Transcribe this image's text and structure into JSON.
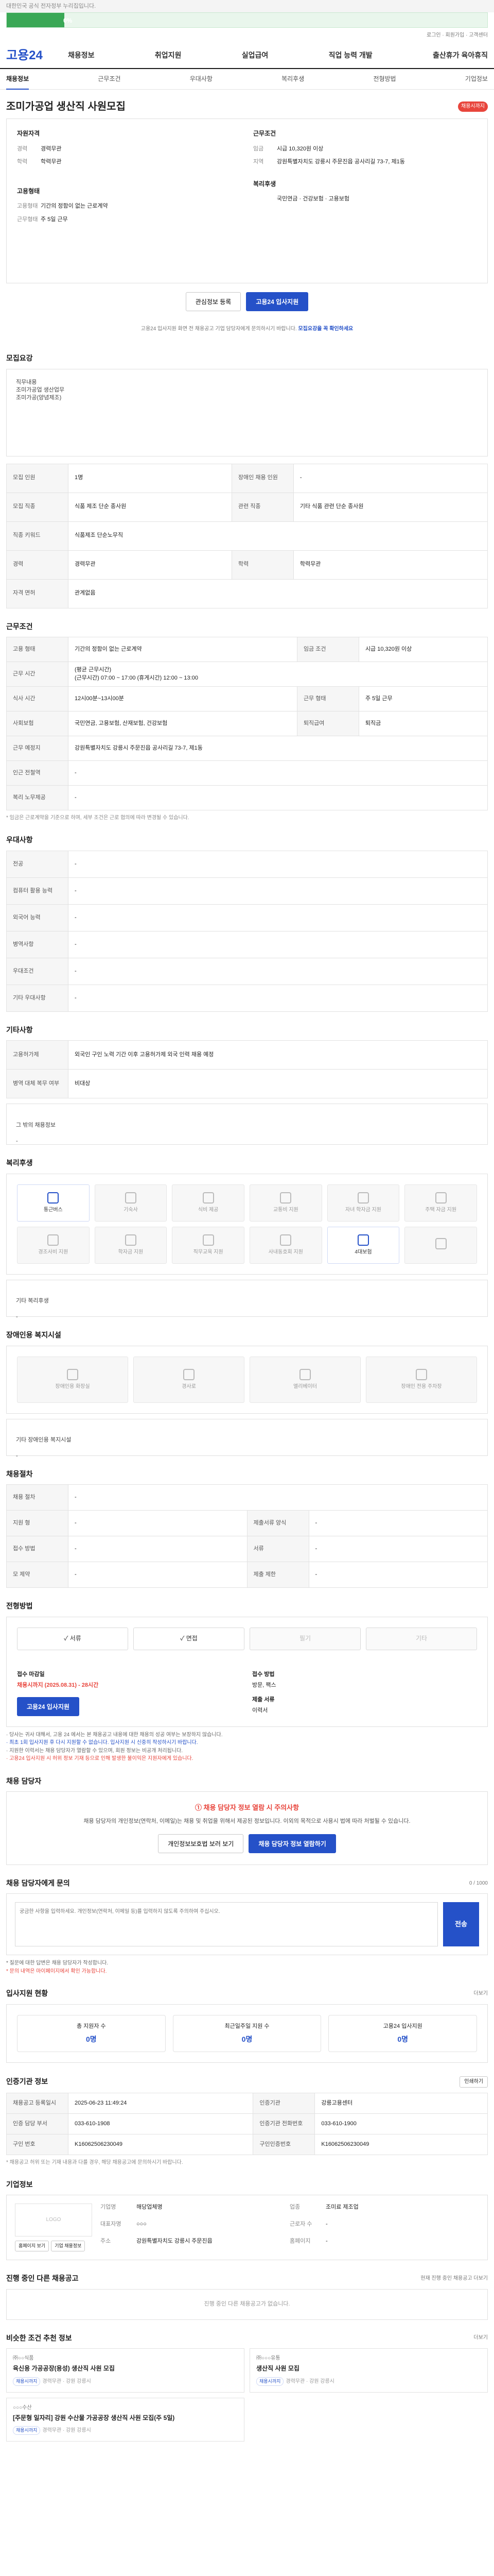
{
  "topbar": {
    "text": "대한민국 공식 전자정부 누리집입니다."
  },
  "notice": {
    "progress": 0.12,
    "progress_label": "0%"
  },
  "utility": {
    "links": "로그인 · 회원가입 · 고객센터"
  },
  "gnb": {
    "logo": "고용24",
    "menu": [
      "채용정보",
      "취업지원",
      "실업급여",
      "직업 능력 개발",
      "출산휴가 육아휴직"
    ]
  },
  "tabs": [
    "채용정보",
    "근무조건",
    "우대사항",
    "복리후생",
    "전형방법",
    "기업정보"
  ],
  "posting": {
    "title": "조미가공업 생산직 사원모집",
    "status_badge": "채용시까지",
    "summary": {
      "left_head": "자원자격",
      "left": [
        {
          "k": "경력",
          "v": "경력무관"
        },
        {
          "k": "학력",
          "v": "학력무관"
        }
      ],
      "left_head2": "고용형태",
      "left2": [
        {
          "k": "고용형태",
          "v": "기간의 정함이 없는 근로계약"
        },
        {
          "k": "근무형태",
          "v": "주 5일 근무"
        }
      ],
      "right_head": "근무조건",
      "right": [
        {
          "k": "임금",
          "v": "시급 10,320원 이상"
        },
        {
          "k": "지역",
          "v": "강원특별자치도 강릉시 주문진읍 공사리길 73-7, 제1동"
        }
      ],
      "right_head2": "복리후생",
      "right2": [
        {
          "k": "",
          "v": "국민연금 · 건강보험 · 고용보험"
        }
      ]
    },
    "buttons": {
      "save": "관심정보 등록",
      "apply": "고용24 입사지원"
    },
    "caption_pre": "고용24 입사지원 화면 전 채용공고 기업 담당자에게 문의하시기 바랍니다.",
    "caption_blue": "모집요강을 꼭 확인하세요"
  },
  "recruit_section": {
    "title": "모집요강",
    "body": "직무내용\n 조미가공업 생산업무\n 조미가공(양념제조)",
    "rows": [
      {
        "k": "모집 인원",
        "v": "1명",
        "k2": "장애인 채용 인원",
        "v2": "-"
      },
      {
        "k": "모집 직종",
        "v": "식품 제조 단순 종사원",
        "k2": "관련 직종",
        "v2": "기타 식품 관련 단순 종사원"
      },
      {
        "k": "직종 키워드",
        "v": "식품제조 단순노무직",
        "k2": "",
        "v2": ""
      },
      {
        "k": "경력",
        "v": "경력무관",
        "k2": "학력",
        "v2": "학력무관"
      },
      {
        "k": "자격 면허",
        "v": "관계없음",
        "k2": "",
        "v2": ""
      }
    ]
  },
  "conditions": {
    "title": "근무조건",
    "rows": [
      {
        "k": "고용 형태",
        "v": "기간의 정함이 없는 근로계약",
        "k2": "임금 조건",
        "v2": "시급 10,320원 이상"
      },
      {
        "k": "근무 시간",
        "v": "(평균 근무시간)\n(근무시간) 07:00 ~ 17:00 (휴게시간) 12:00 ~ 13:00",
        "k2": "",
        "v2": ""
      },
      {
        "k": "식사 시간",
        "v": "12시00분~13시00분",
        "k2": "근무 형태",
        "v2": "주 5일 근무"
      },
      {
        "k": "사회보험",
        "v": "국민연금, 고용보험, 산재보험, 건강보험",
        "k2": "퇴직급여",
        "v2": "퇴직금"
      },
      {
        "k": "근무 예정지",
        "v": "강원특별자치도 강릉시 주문진읍 공사리길 73-7, 제1동",
        "k2": "",
        "v2": ""
      },
      {
        "k": "인근 전철역",
        "v": "-",
        "k2": "",
        "v2": ""
      },
      {
        "k": "복리 노무제공",
        "v": "-",
        "k2": "",
        "v2": ""
      }
    ],
    "note": "* 임금은 근로계약을 기준으로 하며, 세부 조건은 근로 협의에 따라 변경될 수 있습니다."
  },
  "preferences": {
    "title": "우대사항",
    "rows": [
      {
        "k": "전공",
        "v": "-"
      },
      {
        "k": "컴퓨터 활용 능력",
        "v": "-"
      },
      {
        "k": "외국어 능력",
        "v": "-"
      },
      {
        "k": "병역사항",
        "v": "-"
      },
      {
        "k": "우대조건",
        "v": "-"
      },
      {
        "k": "기타 우대사항",
        "v": "-"
      }
    ]
  },
  "etc": {
    "title": "기타사항",
    "rows": [
      {
        "k": "고용허가제",
        "v": "외국인 구인 노력 기간 이후 고용허가제 외국 인력 채용 예정"
      },
      {
        "k": "병역 대체 복무 여부",
        "v": "비대상"
      }
    ],
    "extra_label": "그 밖의 채용정보",
    "extra_value": "-"
  },
  "welfare": {
    "title": "복리후생",
    "items": [
      {
        "label": "통근버스",
        "on": true
      },
      {
        "label": "기숙사",
        "on": false
      },
      {
        "label": "식비 제공",
        "on": false
      },
      {
        "label": "교통비 지원",
        "on": false
      },
      {
        "label": "자녀 학자금 지원",
        "on": false
      },
      {
        "label": "주택 자금 지원",
        "on": false
      },
      {
        "label": "경조사비 지원",
        "on": false
      },
      {
        "label": "학자금 지원",
        "on": false
      },
      {
        "label": "직무교육 지원",
        "on": false
      },
      {
        "label": "사내동호회 지원",
        "on": false
      },
      {
        "label": "4대보험",
        "on": true
      },
      {
        "label": "",
        "on": false
      }
    ],
    "extra_label": "기타 복리후생",
    "extra_value": "-"
  },
  "disability": {
    "title": "장애인용 복지시설",
    "items": [
      "장애인용 화장실",
      "경사로",
      "엘리베이터",
      "장애인 전용 주차장"
    ],
    "extra_label": "기타 장애인용 복지시설",
    "extra_value": "-"
  },
  "screening": {
    "title": "채용절차",
    "rows": [
      {
        "k": "채용 절차",
        "v": "-",
        "k2": "",
        "v2": ""
      },
      {
        "k": "지원 형",
        "v": "-",
        "k2": "제출서류 양식",
        "v2": "-"
      },
      {
        "k": "접수 방법",
        "v": "-",
        "k2": "서류",
        "v2": "-"
      },
      {
        "k": "모 제약",
        "v": "-",
        "k2": "제출 제한",
        "v2": "-"
      }
    ]
  },
  "apply_method": {
    "title": "전형방법",
    "methods": [
      {
        "label": "서류",
        "on": true
      },
      {
        "label": "면접",
        "on": true
      },
      {
        "label": "필기",
        "on": false
      },
      {
        "label": "기타",
        "on": false
      }
    ],
    "receipt_label": "접수 마감일",
    "receipt_value": "채용시까지 (2025.08.31) - 28시간",
    "method_label": "접수 방법",
    "method_value": "방문, 팩스",
    "docs_label": "제출 서류",
    "docs_value": "이력서",
    "apply_button": "고용24 입사지원",
    "bullets": [
      "· 당사는 귀사 대해서, 고용 24 에서는 본 채용공고 내용에 대한 채용의 성공 여부는 보장하지 않습니다.",
      "· 최초 1회 입사지원 후 다시 지원할 수 없습니다. 입사지원 시 신중히 작성하시기 바랍니다.",
      "· 지원한 이력서는 채용 담당자가 열람할 수 있으며, 회원 정보는 비공개 처리됩니다.",
      "· 고용24 입사지원 시 허위 정보 기재 등으로 인해 발생한 불이익은 지원자에게 있습니다."
    ]
  },
  "manager": {
    "title": "채용 담당자",
    "warn_head": "① 채용 담당자 정보 열람 시 주의사항",
    "warn_body": "채용 담당자의 개인정보(연락처, 이메일)는 채용 및 취업을 위해서 제공된 정보입니다. 이외의 목적으로 사용시 법에 따라 처벌될 수 있습니다.",
    "btn_left": "개인정보보호법 보러 보기",
    "btn_right": "채용 담당자 정보 열람하기"
  },
  "qa": {
    "title": "채용 담당자에게 문의",
    "count": "0 / 1000",
    "placeholder": "궁금한 사항을 입력하세요. 개인정보(연락처, 이메일 등)를 입력하지 않도록 주의하여 주십시오.",
    "send": "전송",
    "notes": [
      "* 질문에 대한 답변은 채용 담당자가 작성합니다.",
      "* 문의 내역은 마이페이지에서 확인 가능합니다."
    ]
  },
  "applicants": {
    "title": "입사지원 현황",
    "more": "더보기",
    "stats": [
      {
        "label": "총 지원자 수",
        "value": "0명"
      },
      {
        "label": "최근일주일 지원 수",
        "value": "0명"
      },
      {
        "label": "고용24 입사지원",
        "value": "0명"
      }
    ]
  },
  "info": {
    "title": "인증기관 정보",
    "print": "인쇄하기",
    "rows": [
      {
        "k": "채용공고 등록일시",
        "v": "2025-06-23 11:49:24",
        "k2": "인증기관",
        "v2": "강릉고용센터"
      },
      {
        "k": "인증 담당 부서",
        "v": "033-610-1908",
        "k2": "인증기관 전화번호",
        "v2": "033-610-1900"
      },
      {
        "k": "구인 번호",
        "v": "K16062506230049",
        "k2": "구인인증번호",
        "v2": "K16062506230049"
      }
    ],
    "note": "* 채용공고 허위 또는 기재 내용과 다를 경우, 해당 채용공고에 문의하시기 바랍니다."
  },
  "company": {
    "title": "기업정보",
    "logo_text": "LOGO",
    "fields": [
      {
        "k": "기업명",
        "v": "해당업체명"
      },
      {
        "k": "업종",
        "v": "조미료 제조업"
      },
      {
        "k": "대표자명",
        "v": "○○○"
      },
      {
        "k": "근로자 수",
        "v": "-"
      },
      {
        "k": "주소",
        "v": "강원특별자치도 강릉시 주문진읍"
      },
      {
        "k": "홈페이지",
        "v": "-"
      }
    ],
    "btn_home": "홈페이지 보기",
    "btn_jobs": "기업 채용정보"
  },
  "other_jobs": {
    "title": "진행 중인 다른 채용공고",
    "more": "현재 진행 중인 채용공고 더보기",
    "empty": "진행 중인 다른 채용공고가 없습니다."
  },
  "recommend": {
    "title": "비슷한 조건 추천 정보",
    "more": "더보기",
    "items": [
      {
        "company": "㈜○○식품",
        "title": "육신용 가공공장(용성) 생산직 사원 모집",
        "meta": "경력무관 · 강원 강릉시",
        "tags": [
          "채용시까지"
        ]
      },
      {
        "company": "㈜○○○유통",
        "title": "생산직 사원 모집",
        "meta": "경력무관 · 강원 강릉시",
        "tags": [
          "채용시까지"
        ]
      },
      {
        "company": "○○○수산",
        "title": "[주문형 일자리] 강원 수산물 가공공장 생산직 사원 모집(주 5일)",
        "meta": "경력무관 · 강원 강릉시",
        "tags": [
          "채용시까지"
        ]
      }
    ]
  }
}
